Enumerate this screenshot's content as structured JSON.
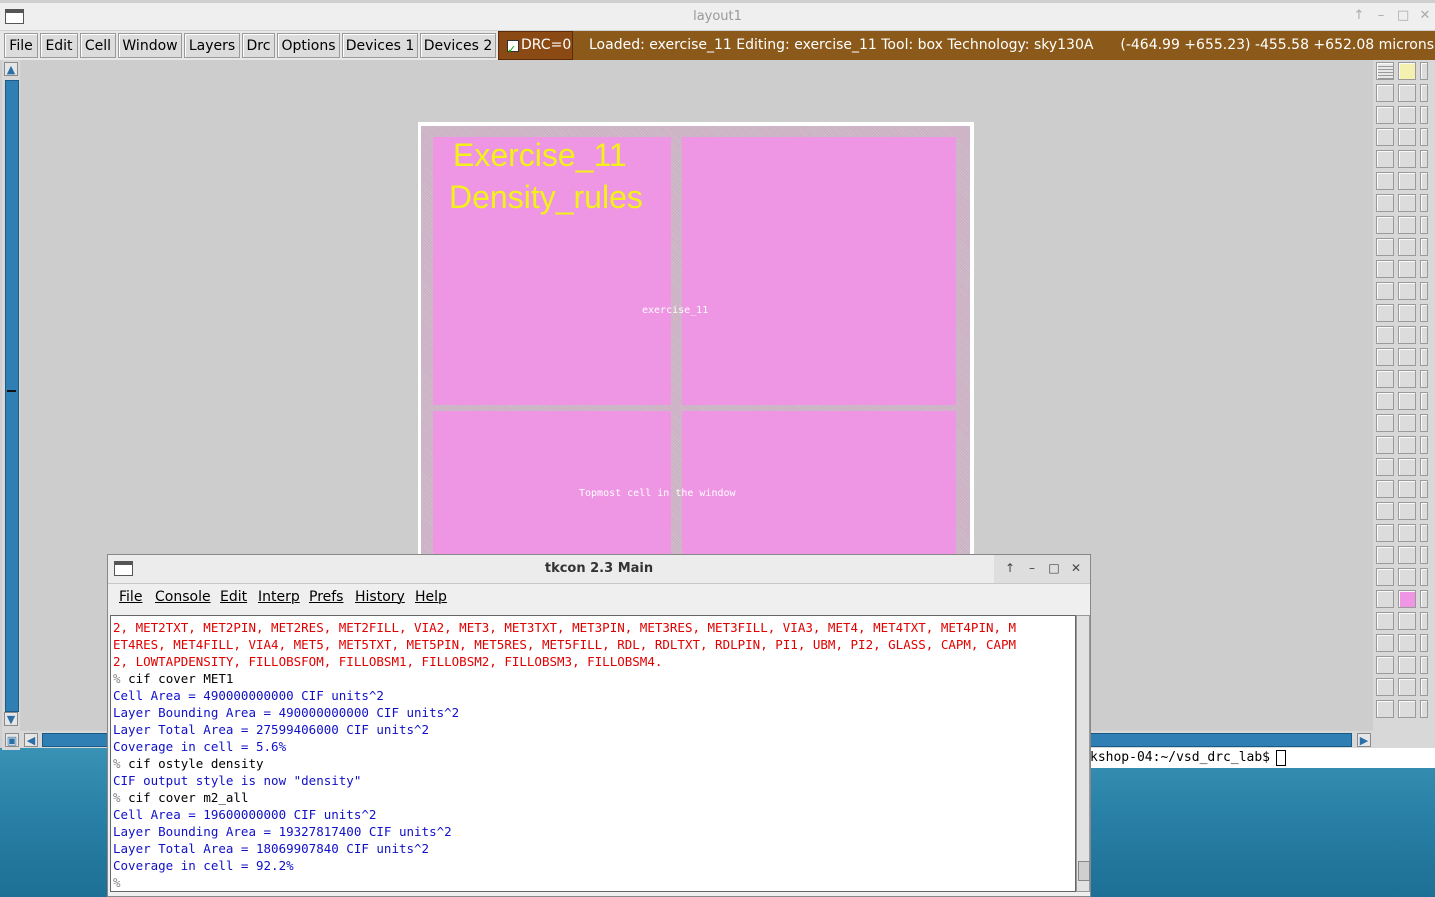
{
  "layout_window": {
    "title": "layout1",
    "menu": [
      "File",
      "Edit",
      "Cell",
      "Window",
      "Layers",
      "Drc",
      "Options",
      "Devices 1",
      "Devices 2"
    ],
    "drc_label": "DRC=0",
    "status_left": "Loaded: exercise_11 Editing: exercise_11 Tool: box  Technology: sky130A",
    "status_right": "(-464.99 +655.23) -455.58 +652.08 microns",
    "window_buttons": [
      "↑",
      "–",
      "□",
      "✕"
    ]
  },
  "canvas": {
    "title_line1": "Exercise_11",
    "title_line2": "Density_rules",
    "cell_label": "exercise_11",
    "topmost_label": "Topmost cell in the window",
    "colors": {
      "pink": "#ee96e3",
      "yellow": "#f2f21a",
      "background": "#cdcdcd"
    }
  },
  "terminal": {
    "prompt": "kshop-04:~/vsd_drc_lab$"
  },
  "tkcon": {
    "title": "tkcon 2.3 Main",
    "menu": [
      "File",
      "Console",
      "Edit",
      "Interp",
      "Prefs",
      "History",
      "Help"
    ],
    "lines": [
      {
        "t": "2, MET2TXT, MET2PIN, MET2RES, MET2FILL, VIA2, MET3, MET3TXT, MET3PIN, MET3RES, MET3FILL, VIA3, MET4, MET4TXT, MET4PIN, M",
        "c": "red"
      },
      {
        "t": "ET4RES, MET4FILL, VIA4, MET5, MET5TXT, MET5PIN, MET5RES, MET5FILL, RDL, RDLTXT, RDLPIN, PI1, UBM, PI2, GLASS, CAPM, CAPM",
        "c": "red"
      },
      {
        "t": "2, LOWTAPDENSITY, FILLOBSFOM, FILLOBSM1, FILLOBSM2, FILLOBSM3, FILLOBSM4.",
        "c": "red"
      },
      {
        "p": "% ",
        "t": "cif cover MET1",
        "c": "cmd"
      },
      {
        "t": "Cell Area = 490000000000 CIF units^2",
        "c": "blue"
      },
      {
        "t": "Layer Bounding Area = 490000000000 CIF units^2",
        "c": "blue"
      },
      {
        "t": "Layer Total Area = 27599406000 CIF units^2",
        "c": "blue"
      },
      {
        "t": "Coverage in cell = 5.6%",
        "c": "blue"
      },
      {
        "p": "% ",
        "t": "cif ostyle density",
        "c": "cmd"
      },
      {
        "t": "CIF output style is now \"density\"",
        "c": "blue"
      },
      {
        "p": "% ",
        "t": "cif cover m2_all",
        "c": "cmd"
      },
      {
        "t": "Cell Area = 19600000000 CIF units^2",
        "c": "blue"
      },
      {
        "t": "Layer Bounding Area = 19327817400 CIF units^2",
        "c": "blue"
      },
      {
        "t": "Layer Total Area = 18069907840 CIF units^2",
        "c": "blue"
      },
      {
        "t": "Coverage in cell = 92.2%",
        "c": "blue"
      },
      {
        "p": "%",
        "t": "",
        "c": "cmd"
      }
    ]
  }
}
